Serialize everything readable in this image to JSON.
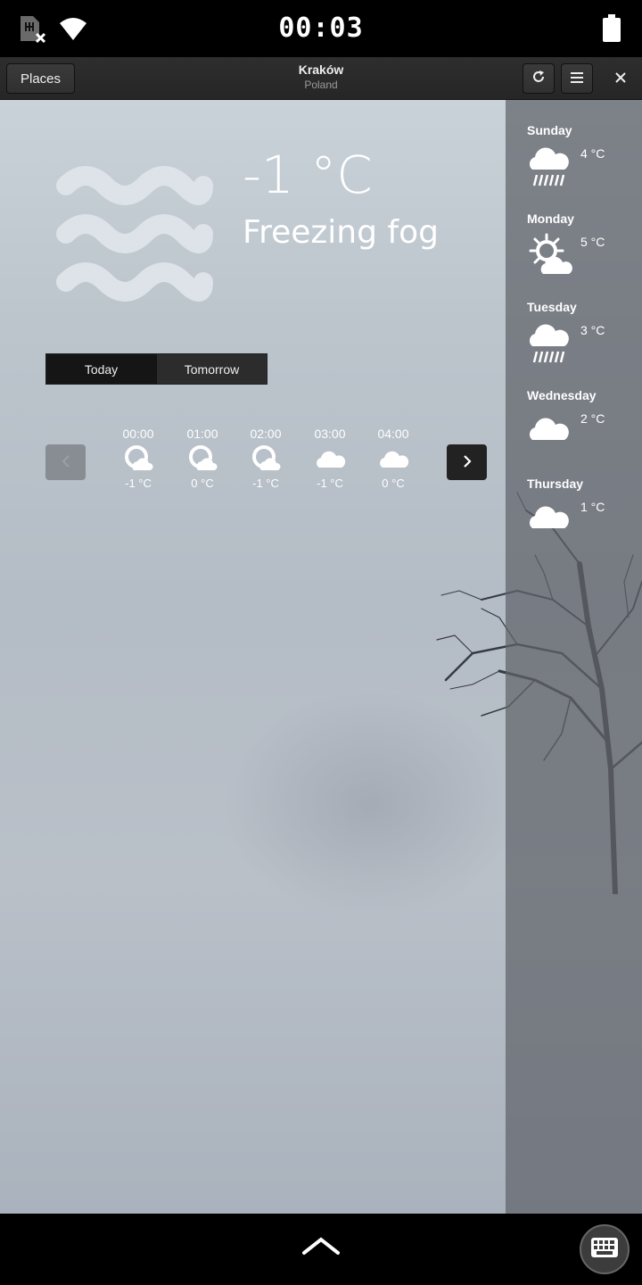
{
  "status_bar": {
    "time": "00:03",
    "icons": [
      "sim-missing-icon",
      "wifi-icon",
      "battery-icon"
    ]
  },
  "header": {
    "places_label": "Places",
    "city": "Kraków",
    "country": "Poland",
    "icons": [
      "refresh-icon",
      "menu-icon",
      "close-icon"
    ]
  },
  "current": {
    "temperature": "-1 °C",
    "condition": "Freezing fog",
    "icon": "fog-icon"
  },
  "tabs": {
    "today": "Today",
    "tomorrow": "Tomorrow"
  },
  "hourly": [
    {
      "time": "00:00",
      "temp": "-1 °C",
      "icon": "night-clouds-icon"
    },
    {
      "time": "01:00",
      "temp": "0 °C",
      "icon": "night-clouds-icon"
    },
    {
      "time": "02:00",
      "temp": "-1 °C",
      "icon": "night-clouds-icon"
    },
    {
      "time": "03:00",
      "temp": "-1 °C",
      "icon": "cloud-icon"
    },
    {
      "time": "04:00",
      "temp": "0 °C",
      "icon": "cloud-icon"
    }
  ],
  "forecast": [
    {
      "day": "Sunday",
      "temp": "4 °C",
      "icon": "rain-icon"
    },
    {
      "day": "Monday",
      "temp": "5 °C",
      "icon": "sun-cloud-icon"
    },
    {
      "day": "Tuesday",
      "temp": "3 °C",
      "icon": "rain-icon"
    },
    {
      "day": "Wednesday",
      "temp": "2 °C",
      "icon": "cloud-icon"
    },
    {
      "day": "Thursday",
      "temp": "1 °C",
      "icon": "cloud-icon"
    }
  ],
  "bottom_bar": {
    "icons": [
      "chevron-up-icon",
      "keyboard-icon"
    ]
  },
  "colors": {
    "panel_bg": "#2b2b2b",
    "sky_top": "#c9d2d9",
    "sky_bottom": "#aab2bd"
  }
}
